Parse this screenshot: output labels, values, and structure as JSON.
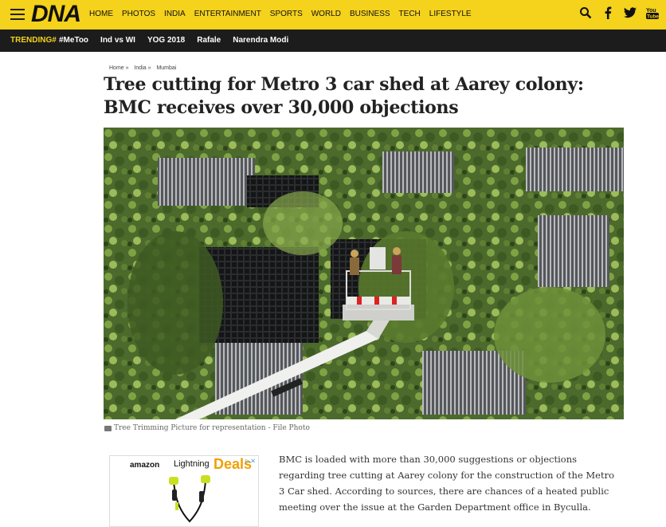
{
  "header": {
    "logo": "DNA",
    "nav": [
      "HOME",
      "PHOTOS",
      "INDIA",
      "ENTERTAINMENT",
      "SPORTS",
      "WORLD",
      "BUSINESS",
      "TECH",
      "LIFESTYLE"
    ],
    "icons": [
      "search-icon",
      "facebook-icon",
      "twitter-icon",
      "youtube-icon"
    ]
  },
  "trending": {
    "label": "TRENDING#",
    "items": [
      "#MeToo",
      "Ind vs WI",
      "YOG 2018",
      "Rafale",
      "Narendra Modi"
    ]
  },
  "breadcrumb": [
    "Home »",
    "India »",
    "Mumbai"
  ],
  "article": {
    "title": "Tree cutting for Metro 3 car shed at Aarey colony: BMC receives over 30,000 objections",
    "caption": "Tree Trimming Picture for representation - File Photo",
    "body": "BMC is loaded with more than 30,000 suggestions or objections regarding tree cutting at Aarey colony for the construction of the Metro 3 Car shed. According to sources, there are chances of a heated public meeting over the issue at the Garden Department office in Byculla."
  },
  "ad": {
    "brand": "amazon",
    "lightning": "Lightning",
    "deals": "Deals",
    "adchoice": "▷✕"
  },
  "colors": {
    "brand_yellow": "#f5d21b",
    "trending_bar": "#1c1c1c",
    "deals_orange": "#f0a000"
  }
}
